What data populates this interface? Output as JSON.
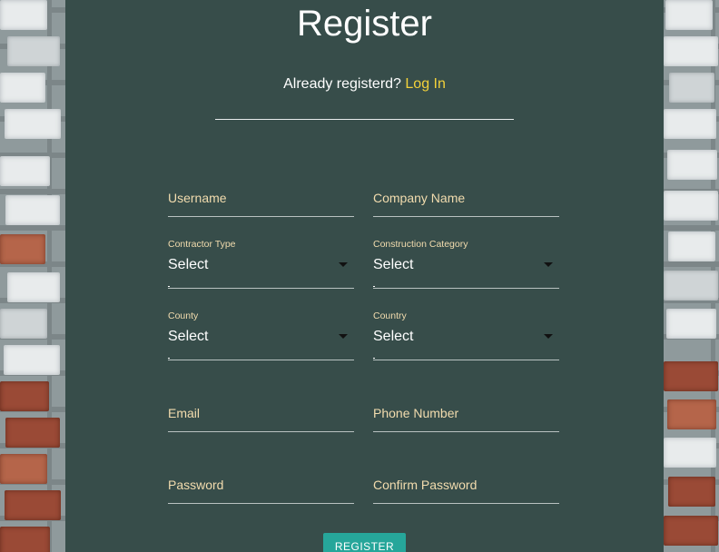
{
  "page": {
    "title": "Register",
    "already_text": "Already registerd?",
    "login_link": "Log In"
  },
  "form": {
    "username": {
      "placeholder": "Username"
    },
    "company_name": {
      "placeholder": "Company Name"
    },
    "contractor_type": {
      "label": "Contractor Type",
      "value": "Select"
    },
    "construction_category": {
      "label": "Construction Category",
      "value": "Select"
    },
    "county": {
      "label": "County",
      "value": "Select"
    },
    "country": {
      "label": "Country",
      "value": "Select"
    },
    "email": {
      "placeholder": "Email"
    },
    "phone_number": {
      "placeholder": "Phone Number"
    },
    "password": {
      "placeholder": "Password"
    },
    "confirm_password": {
      "placeholder": "Confirm Password"
    },
    "submit_label": "REGISTER"
  },
  "colors": {
    "panel_background": "#374d4a",
    "label_color": "#f2dcae",
    "link_color": "#f3d23a",
    "button_color": "#26a69a"
  },
  "icons": {
    "dropdown": "caret-down-icon",
    "background": "brick-wall"
  }
}
